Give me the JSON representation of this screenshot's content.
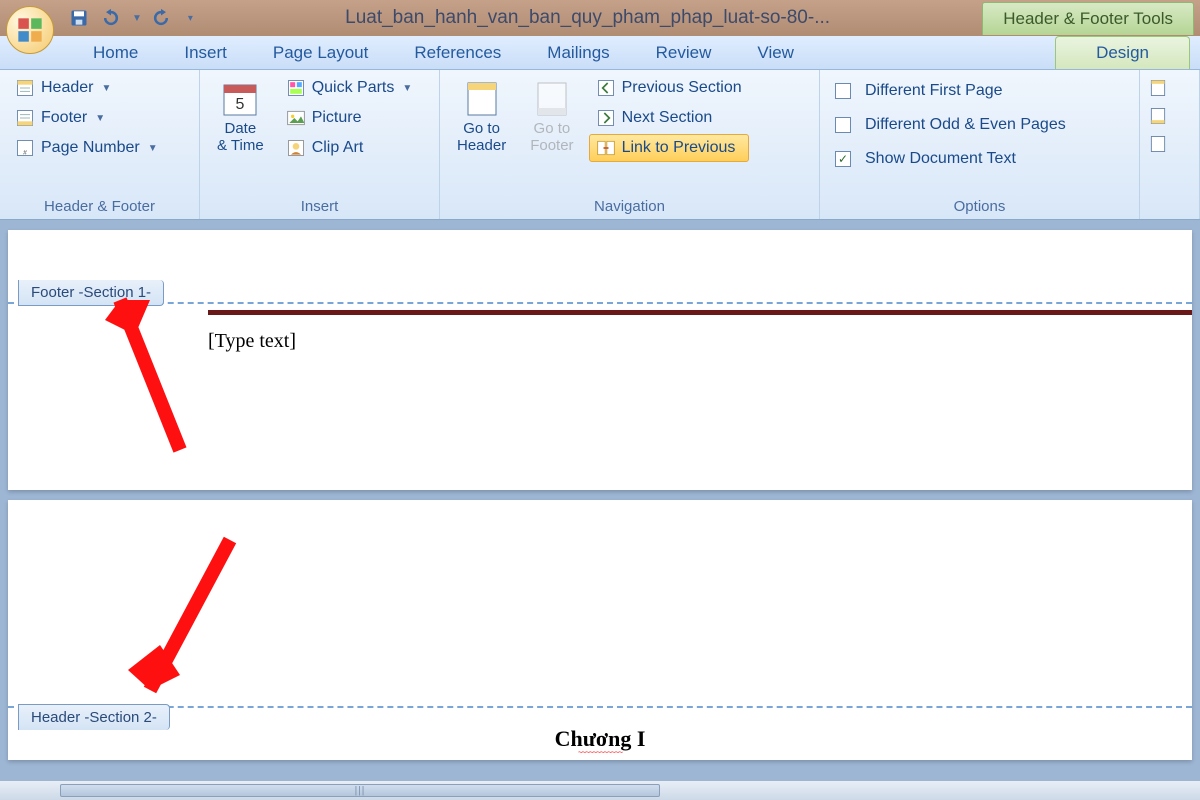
{
  "title": "Luat_ban_hanh_van_ban_quy_pham_phap_luat-so-80-...",
  "context_tab": "Header & Footer Tools",
  "tabs": [
    "Home",
    "Insert",
    "Page Layout",
    "References",
    "Mailings",
    "Review",
    "View"
  ],
  "active_tab": "Design",
  "ribbon": {
    "group1": {
      "label": "Header & Footer",
      "header": "Header",
      "footer": "Footer",
      "page_number": "Page Number"
    },
    "group2": {
      "label": "Insert",
      "date_time": "Date\n& Time",
      "quick_parts": "Quick Parts",
      "picture": "Picture",
      "clip_art": "Clip Art"
    },
    "group3": {
      "label": "Navigation",
      "goto_header": "Go to\nHeader",
      "goto_footer": "Go to\nFooter",
      "prev_section": "Previous Section",
      "next_section": "Next Section",
      "link_prev": "Link to Previous"
    },
    "group4": {
      "label": "Options",
      "diff_first": "Different First Page",
      "diff_odd_even": "Different Odd & Even Pages",
      "show_doc": "Show Document Text",
      "show_doc_checked": true
    }
  },
  "document": {
    "footer_tag": "Footer -Section 1-",
    "header_tag": "Header -Section 2-",
    "placeholder": "[Type text]",
    "heading": "Chương I"
  }
}
